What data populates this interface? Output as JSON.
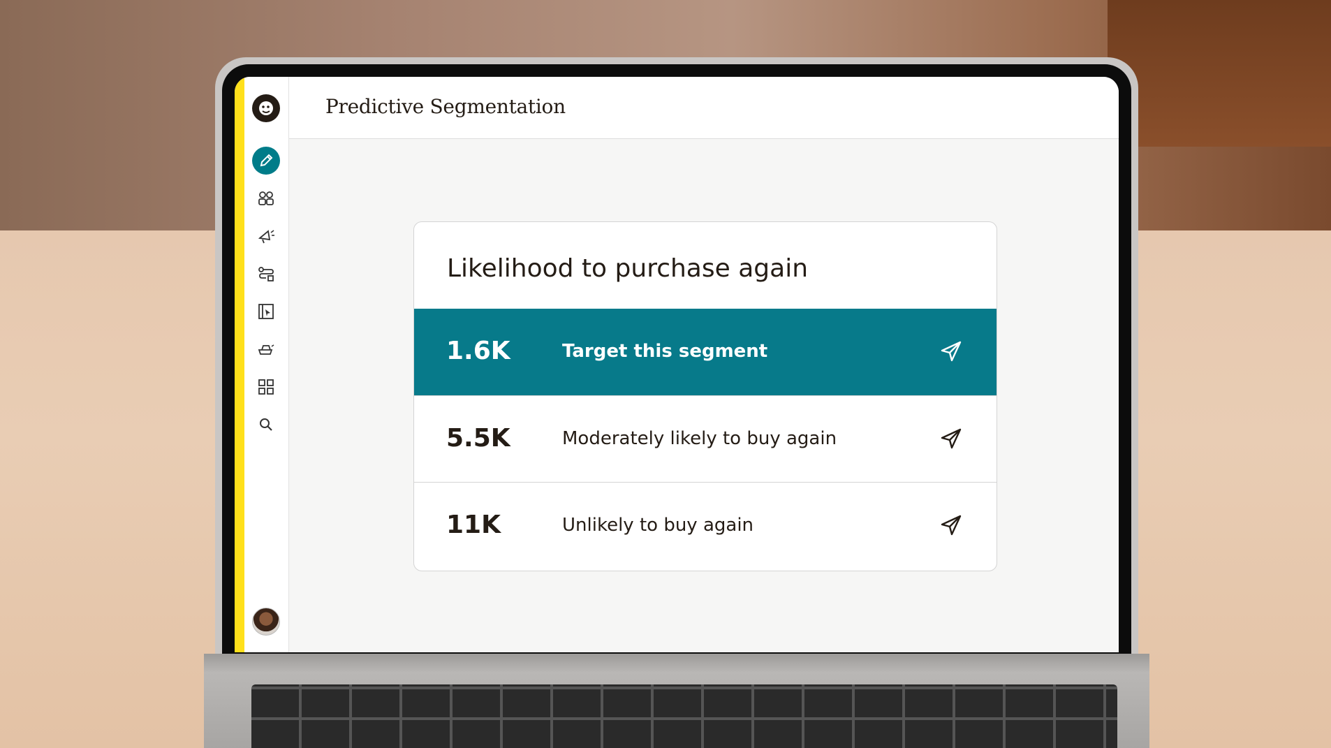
{
  "app": {
    "page_title": "Predictive Segmentation"
  },
  "sidebar": {
    "logo": "mailchimp-freddie-logo-icon",
    "items": [
      {
        "icon": "pencil-icon",
        "active": true
      },
      {
        "icon": "audience-icon",
        "active": false
      },
      {
        "icon": "megaphone-icon",
        "active": false
      },
      {
        "icon": "automations-icon",
        "active": false
      },
      {
        "icon": "website-icon",
        "active": false
      },
      {
        "icon": "integrations-icon",
        "active": false
      },
      {
        "icon": "content-grid-icon",
        "active": false
      },
      {
        "icon": "search-icon",
        "active": false
      }
    ],
    "avatar": "user-avatar"
  },
  "card": {
    "title": "Likelihood to purchase again",
    "segments": [
      {
        "count": "1.6K",
        "label": "Target this segment",
        "highlighted": true
      },
      {
        "count": "5.5K",
        "label": "Moderately likely to buy again",
        "highlighted": false
      },
      {
        "count": "11K",
        "label": "Unlikely to buy again",
        "highlighted": false
      }
    ]
  },
  "colors": {
    "accent": "#007c89",
    "highlight_row": "#077a8a",
    "brand_yellow": "#ffe01b",
    "text": "#241c15"
  }
}
